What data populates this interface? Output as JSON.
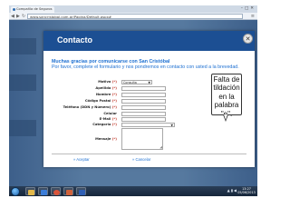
{
  "browser": {
    "tab_title": "Compañía de Seguros",
    "url": "www.sancristobal.com.ar/Pagina/Default.aspx#"
  },
  "modal": {
    "title": "Contacto",
    "close_label": "✕",
    "greeting": "Muchas gracias por comunicarse con San Cristóbal",
    "instructions": "Por favor, complete el formulario y nos pondremos en contacto con usted a la brevedad.",
    "required_mark": "(*)",
    "fields": [
      {
        "label": "Motivo",
        "value": "Consulta",
        "type": "select"
      },
      {
        "label": "Apellido",
        "value": "",
        "type": "text"
      },
      {
        "label": "Nombre",
        "value": "",
        "type": "text"
      },
      {
        "label": "Código Postal",
        "value": "",
        "type": "text"
      },
      {
        "label": "Teléfono (DDN y Número)",
        "value": "",
        "type": "text"
      },
      {
        "label": "Celular",
        "value": "",
        "type": "text"
      },
      {
        "label": "E-Mail",
        "value": "",
        "type": "text"
      },
      {
        "label": "Categoría",
        "value": "",
        "type": "select"
      },
      {
        "label": "Mensaje",
        "value": "",
        "type": "textarea"
      }
    ],
    "accept_label": "» Aceptar",
    "cancel_label": "» Cancelar"
  },
  "callout": {
    "text": "Falta de tildación en la palabra \"e\"."
  },
  "taskbar": {
    "clock_time": "13:27",
    "clock_date": "05/06/2013"
  },
  "colors": {
    "modal_header": "#1c4f93",
    "link_blue": "#1c6fd1",
    "required_red": "#c0392b"
  }
}
